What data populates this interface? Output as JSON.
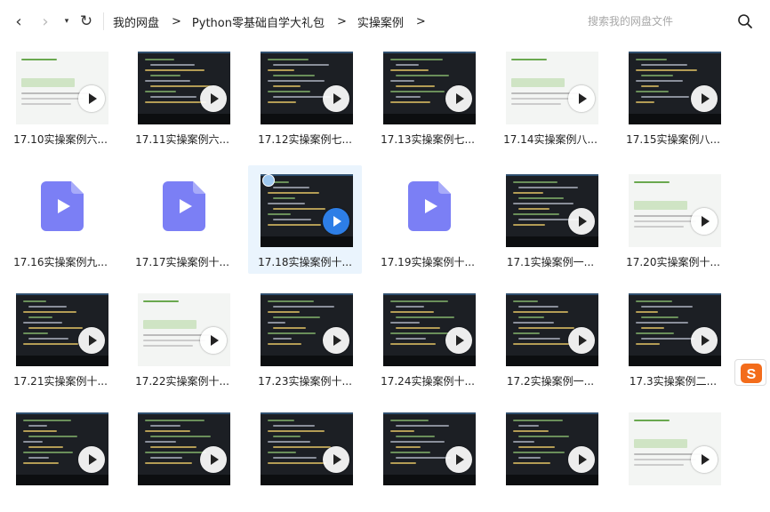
{
  "nav": {
    "back": "‹",
    "forward": "›",
    "dropdown": "▾",
    "refresh": "↻"
  },
  "breadcrumb": {
    "items": [
      "我的网盘",
      "Python零基础自学大礼包",
      "实操案例"
    ],
    "separator": ">"
  },
  "search": {
    "placeholder": "搜索我的网盘文件",
    "value": ""
  },
  "colors": {
    "selection": "#eaf4fd",
    "play_blue": "#2d7ee6",
    "file_icon": "#7b7ff5",
    "ime_orange": "#f36c1b"
  },
  "files": [
    {
      "name": "17.10实操案例六...",
      "kind": "video-light"
    },
    {
      "name": "17.11实操案例六...",
      "kind": "video"
    },
    {
      "name": "17.12实操案例七...",
      "kind": "video"
    },
    {
      "name": "17.13实操案例七...",
      "kind": "video"
    },
    {
      "name": "17.14实操案例八...",
      "kind": "video-light"
    },
    {
      "name": "17.15实操案例八...",
      "kind": "video"
    },
    {
      "name": "17.16实操案例九...",
      "kind": "file"
    },
    {
      "name": "17.17实操案例十...",
      "kind": "file"
    },
    {
      "name": "17.18实操案例十...",
      "kind": "video",
      "selected": true
    },
    {
      "name": "17.19实操案例十...",
      "kind": "file"
    },
    {
      "name": "17.1实操案例一...",
      "kind": "video"
    },
    {
      "name": "17.20实操案例十...",
      "kind": "video-light"
    },
    {
      "name": "17.21实操案例十...",
      "kind": "video"
    },
    {
      "name": "17.22实操案例十...",
      "kind": "video-light"
    },
    {
      "name": "17.23实操案例十...",
      "kind": "video"
    },
    {
      "name": "17.24实操案例十...",
      "kind": "video"
    },
    {
      "name": "17.2实操案例一...",
      "kind": "video"
    },
    {
      "name": "17.3实操案例二...",
      "kind": "video"
    },
    {
      "name": "",
      "kind": "video"
    },
    {
      "name": "",
      "kind": "video"
    },
    {
      "name": "",
      "kind": "video"
    },
    {
      "name": "",
      "kind": "video"
    },
    {
      "name": "",
      "kind": "video"
    },
    {
      "name": "",
      "kind": "video-light"
    }
  ]
}
